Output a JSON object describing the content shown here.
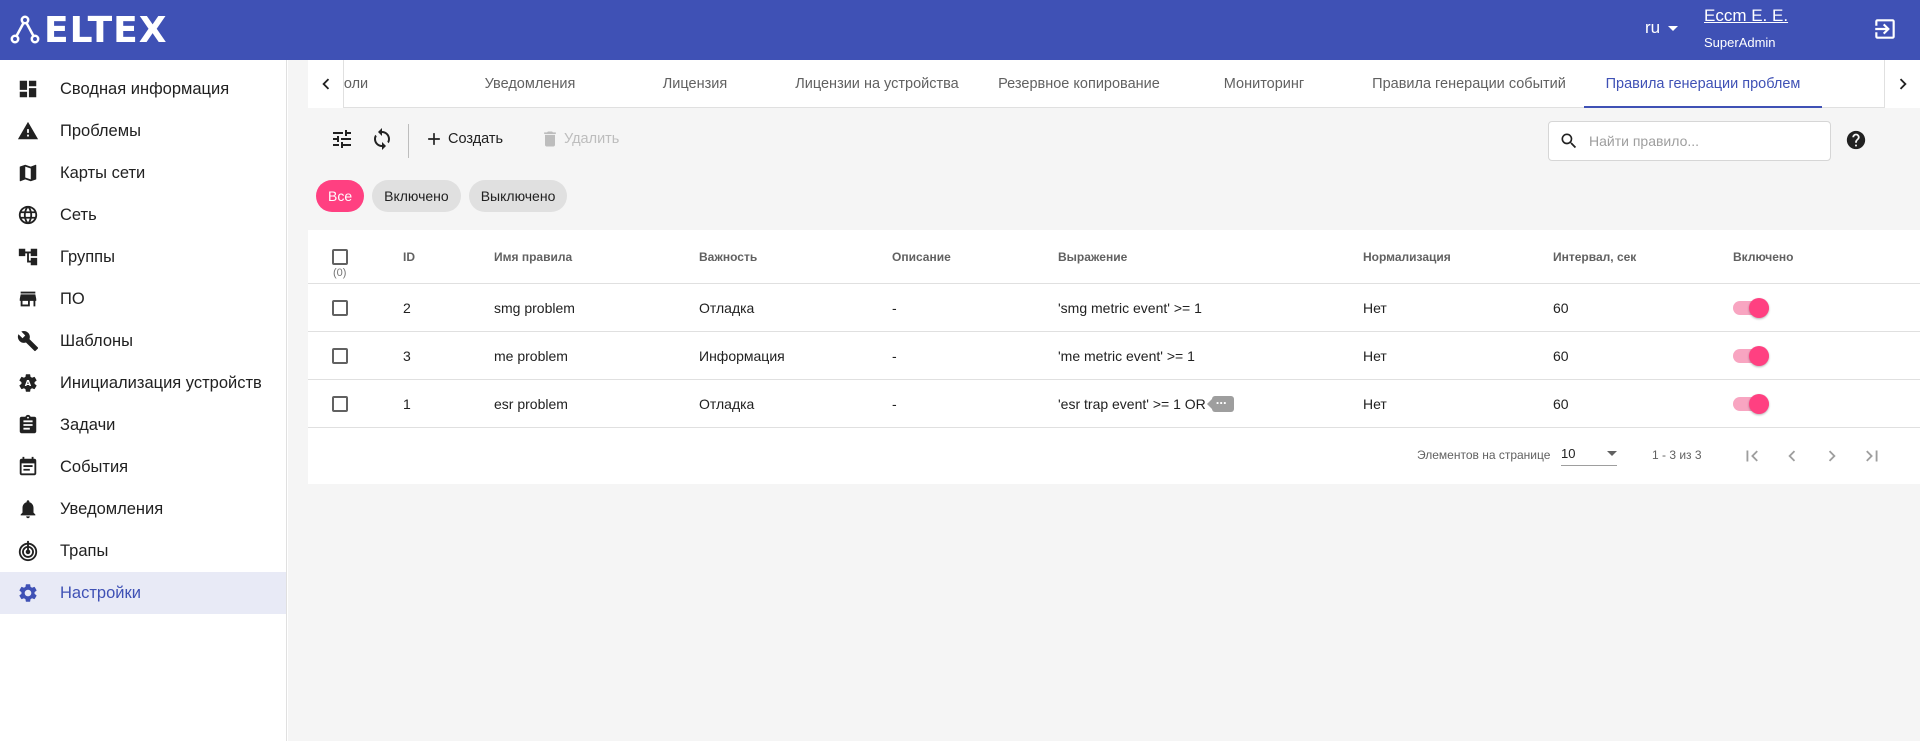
{
  "header": {
    "logo": "ELTEX",
    "language": "ru",
    "user_name": "Eccm E. E.",
    "user_role": "SuperAdmin"
  },
  "sidebar": {
    "items": [
      {
        "label": "Сводная информация",
        "icon": "dashboard-icon"
      },
      {
        "label": "Проблемы",
        "icon": "warning-icon"
      },
      {
        "label": "Карты сети",
        "icon": "map-icon"
      },
      {
        "label": "Сеть",
        "icon": "globe-icon"
      },
      {
        "label": "Группы",
        "icon": "hierarchy-icon"
      },
      {
        "label": "ПО",
        "icon": "store-icon"
      },
      {
        "label": "Шаблоны",
        "icon": "wrench-icon"
      },
      {
        "label": "Инициализация устройств",
        "icon": "auto-config-icon"
      },
      {
        "label": "Задачи",
        "icon": "clipboard-icon"
      },
      {
        "label": "События",
        "icon": "calendar-icon"
      },
      {
        "label": "Уведомления",
        "icon": "bell-icon"
      },
      {
        "label": "Трапы",
        "icon": "radar-icon"
      },
      {
        "label": "Настройки",
        "icon": "gear-icon"
      }
    ],
    "active_index": 12
  },
  "tabs": [
    "оли",
    "Уведомления",
    "Лицензия",
    "Лицензии на устройства",
    "Резервное копирование",
    "Мониторинг",
    "Правила генерации событий",
    "Правила генерации проблем"
  ],
  "toolbar": {
    "create_label": "Создать",
    "delete_label": "Удалить",
    "search_placeholder": "Найти правило..."
  },
  "filters": [
    "Все",
    "Включено",
    "Выключено"
  ],
  "table": {
    "columns": [
      "ID",
      "Имя правила",
      "Важность",
      "Описание",
      "Выражение",
      "Нормализация",
      "Интервал, сек",
      "Включено"
    ],
    "selected_count": "(0)",
    "rows": [
      {
        "id": "2",
        "name": "smg problem",
        "severity": "Отладка",
        "description": "-",
        "expression": "'smg metric event' >= 1",
        "normalization": "Нет",
        "interval": "60",
        "enabled": true,
        "truncated": false
      },
      {
        "id": "3",
        "name": "me problem",
        "severity": "Информация",
        "description": "-",
        "expression": "'me metric event' >= 1",
        "normalization": "Нет",
        "interval": "60",
        "enabled": true,
        "truncated": false
      },
      {
        "id": "1",
        "name": "esr problem",
        "severity": "Отладка",
        "description": "-",
        "expression": "'esr trap event' >= 1 OR",
        "normalization": "Нет",
        "interval": "60",
        "enabled": true,
        "truncated": true
      }
    ]
  },
  "paginator": {
    "items_per_page_label": "Элементов на странице",
    "page_size": "10",
    "range_label": "1 - 3 из 3"
  },
  "colors": {
    "primary": "#3f51b5",
    "accent": "#ff4081"
  }
}
